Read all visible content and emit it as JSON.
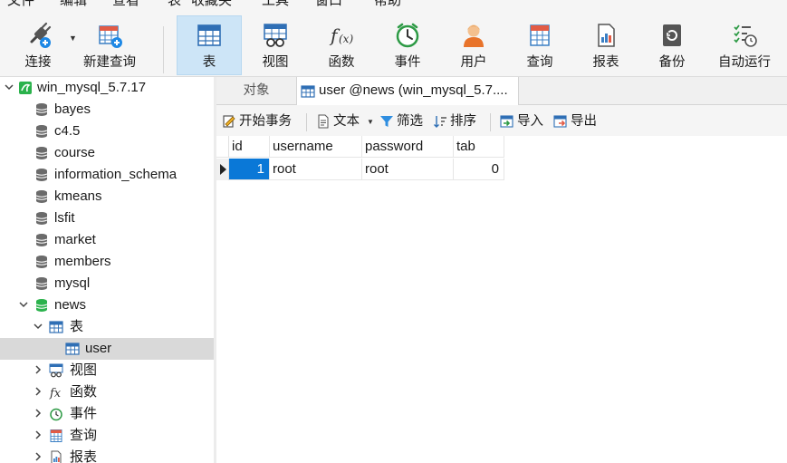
{
  "menubar": {
    "items": [
      "文件",
      "编辑",
      "查看",
      "表",
      "收藏夹",
      "工具",
      "窗口",
      "帮助"
    ]
  },
  "toolbar": {
    "buttons": [
      {
        "label": "连接",
        "icon": "plug-icon"
      },
      {
        "label": "新建查询",
        "icon": "new-query-icon"
      },
      {
        "label": "表",
        "icon": "table-icon",
        "active": true
      },
      {
        "label": "视图",
        "icon": "view-icon"
      },
      {
        "label": "函数",
        "icon": "function-icon"
      },
      {
        "label": "事件",
        "icon": "clock-icon"
      },
      {
        "label": "用户",
        "icon": "user-icon"
      },
      {
        "label": "查询",
        "icon": "query-icon"
      },
      {
        "label": "报表",
        "icon": "report-icon"
      },
      {
        "label": "备份",
        "icon": "backup-icon"
      },
      {
        "label": "自动运行",
        "icon": "auto-run-icon"
      }
    ]
  },
  "tree": {
    "connection": "win_mysql_5.7.17",
    "databases": [
      "bayes",
      "c4.5",
      "course",
      "information_schema",
      "kmeans",
      "lsfit",
      "market",
      "members",
      "mysql",
      "news"
    ],
    "open_db": "news",
    "nodes": {
      "tables": "表",
      "table_user": "user",
      "views": "视图",
      "functions": "函数",
      "events": "事件",
      "queries": "查询",
      "reports": "报表"
    }
  },
  "tabs": {
    "objects": "对象",
    "active": "user @news (win_mysql_5.7...."
  },
  "data_toolbar": {
    "begin_transaction": "开始事务",
    "text": "文本",
    "filter": "筛选",
    "sort": "排序",
    "import": "导入",
    "export": "导出"
  },
  "grid": {
    "columns": [
      "id",
      "username",
      "password",
      "tab"
    ],
    "rows": [
      {
        "id": "1",
        "username": "root",
        "password": "root",
        "tab": "0"
      }
    ]
  },
  "colors": {
    "accent": "#0a78d7",
    "active_tool": "#cde5f7",
    "db_green": "#2bb24c"
  }
}
